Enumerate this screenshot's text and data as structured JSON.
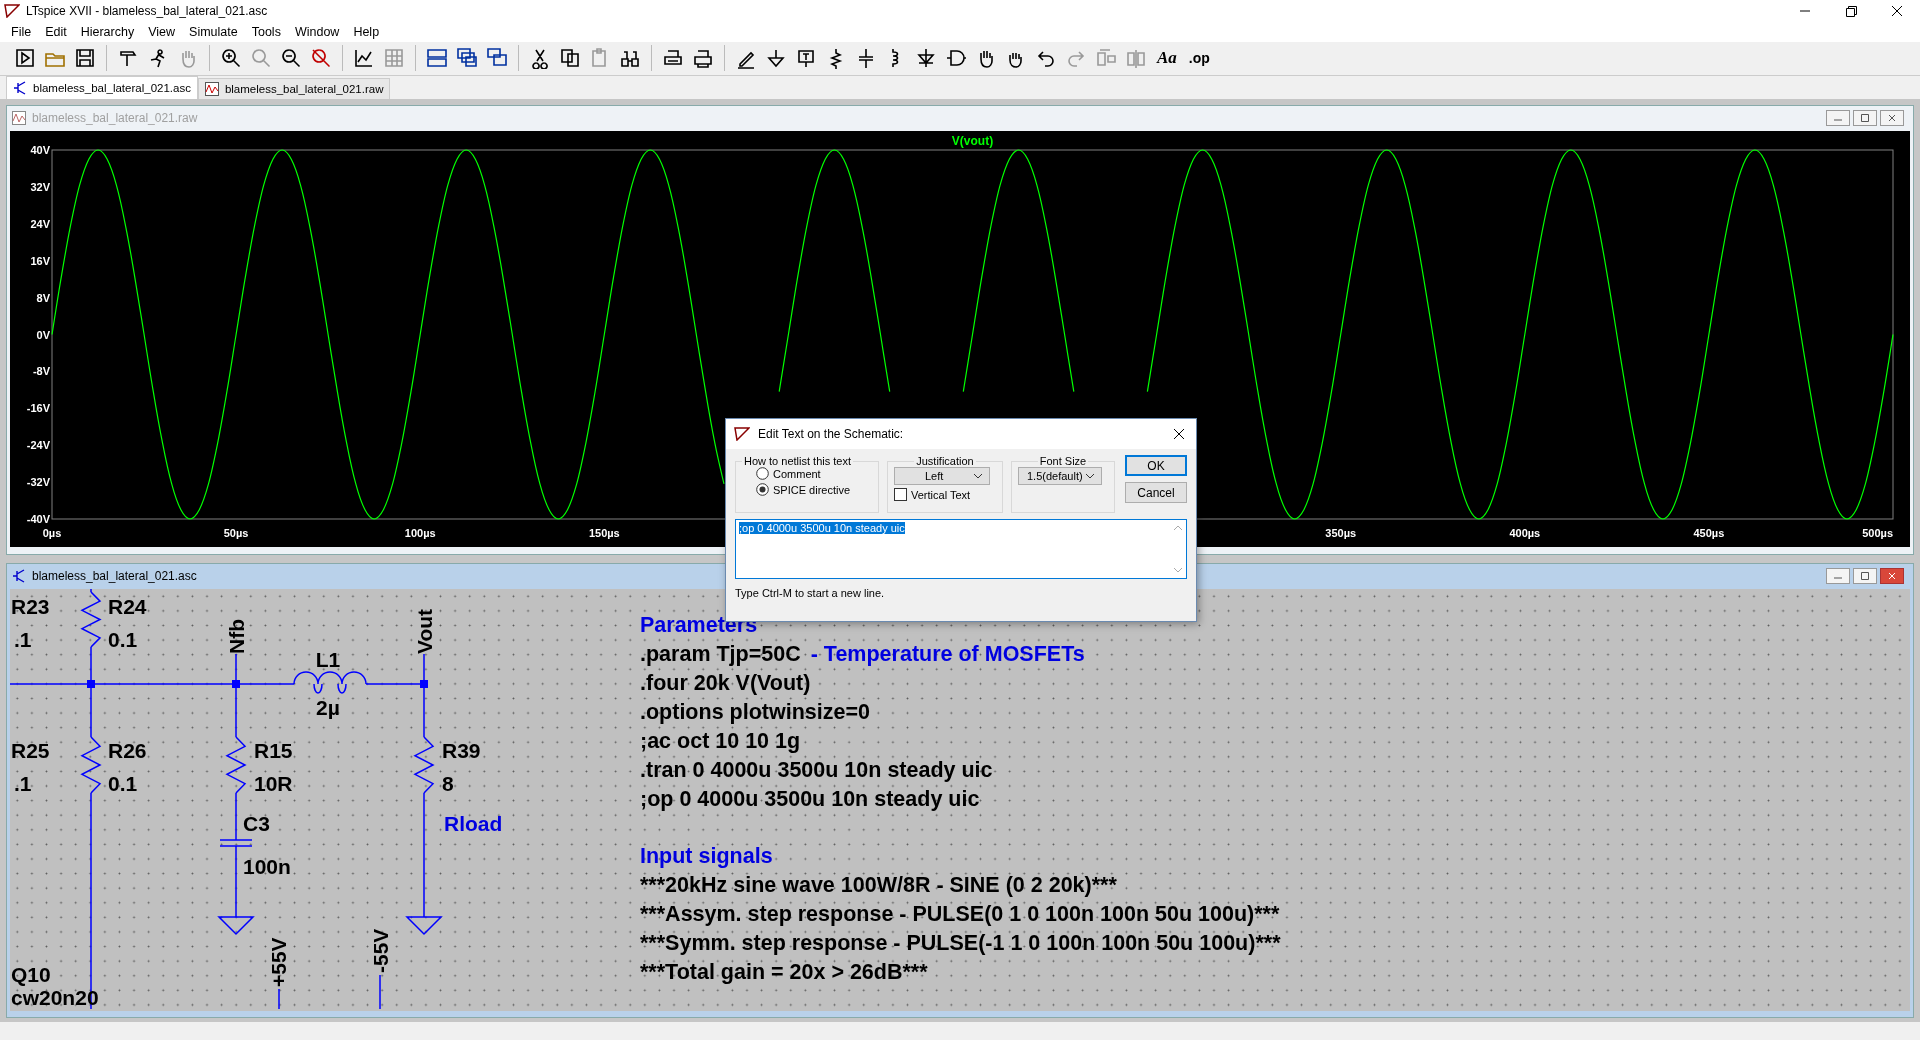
{
  "window": {
    "title": "LTspice XVII - blameless_bal_lateral_021.asc"
  },
  "menu": [
    "File",
    "Edit",
    "Hierarchy",
    "View",
    "Simulate",
    "Tools",
    "Window",
    "Help"
  ],
  "toolbar": {
    "font_button": "Aa",
    "op_button": ".op"
  },
  "tabs": [
    {
      "label": "blameless_bal_lateral_021.asc",
      "kind": "schematic",
      "selected": true
    },
    {
      "label": "blameless_bal_lateral_021.raw",
      "kind": "waveform",
      "selected": false
    }
  ],
  "plot_window": {
    "title": "blameless_bal_lateral_021.raw",
    "active": false,
    "chart_data": {
      "type": "line",
      "xlim": [
        0,
        500
      ],
      "ylim": [
        -40,
        40
      ],
      "yticks": [
        {
          "value": 40,
          "label": "40V"
        },
        {
          "value": 32,
          "label": "32V"
        },
        {
          "value": 24,
          "label": "24V"
        },
        {
          "value": 16,
          "label": "16V"
        },
        {
          "value": 8,
          "label": "8V"
        },
        {
          "value": 0,
          "label": "0V"
        },
        {
          "value": -8,
          "label": "-8V"
        },
        {
          "value": -16,
          "label": "-16V"
        },
        {
          "value": -24,
          "label": "-24V"
        },
        {
          "value": -32,
          "label": "-32V"
        },
        {
          "value": -40,
          "label": "-40V"
        }
      ],
      "xticks": [
        {
          "value": 0,
          "label": "0µs"
        },
        {
          "value": 50,
          "label": "50µs"
        },
        {
          "value": 100,
          "label": "100µs"
        },
        {
          "value": 150,
          "label": "150µs"
        },
        {
          "value": 350,
          "label": "350µs"
        },
        {
          "value": 400,
          "label": "400µs"
        },
        {
          "value": 450,
          "label": "450µs"
        },
        {
          "value": 500,
          "label": "500µs"
        }
      ],
      "x": [
        0,
        2.5,
        5,
        7.5,
        10,
        12.5,
        15,
        17.5,
        20,
        22.5,
        25,
        27.5,
        30,
        32.5,
        35,
        37.5,
        40,
        42.5,
        45,
        47.5,
        50,
        52.5,
        55,
        57.5,
        60,
        62.5,
        65,
        67.5,
        70,
        72.5,
        75,
        77.5,
        80,
        82.5,
        85,
        87.5,
        90,
        92.5,
        95,
        97.5,
        100,
        102.5,
        105,
        107.5,
        110,
        112.5,
        115,
        117.5,
        120,
        122.5,
        125,
        127.5,
        130,
        132.5,
        135,
        137.5,
        140,
        142.5,
        145,
        147.5,
        150,
        152.5,
        155,
        157.5,
        160,
        162.5,
        165,
        167.5,
        170,
        172.5,
        175,
        177.5,
        180,
        182.5,
        185,
        187.5,
        190,
        192.5,
        195,
        197.5,
        200,
        202.5,
        205,
        207.5,
        210,
        212.5,
        215,
        217.5,
        220,
        222.5,
        225,
        227.5,
        230,
        232.5,
        235,
        237.5,
        240,
        242.5,
        245,
        247.5,
        250,
        252.5,
        255,
        257.5,
        260,
        262.5,
        265,
        267.5,
        270,
        272.5,
        275,
        277.5,
        280,
        282.5,
        285,
        287.5,
        290,
        292.5,
        295,
        297.5,
        300,
        302.5,
        305,
        307.5,
        310,
        312.5,
        315,
        317.5,
        320,
        322.5,
        325,
        327.5,
        330,
        332.5,
        335,
        337.5,
        340,
        342.5,
        345,
        347.5,
        350,
        352.5,
        355,
        357.5,
        360,
        362.5,
        365,
        367.5,
        370,
        372.5,
        375,
        377.5,
        380,
        382.5,
        385,
        387.5,
        390,
        392.5,
        395,
        397.5,
        400,
        402.5,
        405,
        407.5,
        410,
        412.5,
        415,
        417.5,
        420,
        422.5,
        425,
        427.5,
        430,
        432.5,
        435,
        437.5,
        440,
        442.5,
        445,
        447.5,
        450,
        452.5,
        455,
        457.5,
        460,
        462.5,
        465,
        467.5,
        470,
        472.5,
        475,
        477.5,
        480,
        482.5,
        485,
        487.5,
        490,
        492.5,
        495,
        497.5,
        500
      ],
      "series": [
        {
          "name": "V(vout)",
          "color": "#00ff00",
          "values": [
            0,
            12.4,
            23.5,
            32.4,
            38,
            40,
            38,
            32.4,
            23.5,
            12.4,
            0,
            -12.4,
            -23.5,
            -32.4,
            -38,
            -40,
            -38,
            -32.4,
            -23.5,
            -12.4,
            0,
            12.4,
            23.5,
            32.4,
            38,
            40,
            38,
            32.4,
            23.5,
            12.4,
            0,
            -12.4,
            -23.5,
            -32.4,
            -38,
            -40,
            -38,
            -32.4,
            -23.5,
            -12.4,
            0,
            12.4,
            23.5,
            32.4,
            38,
            40,
            38,
            32.4,
            23.5,
            12.4,
            0,
            -12.4,
            -23.5,
            -32.4,
            -38,
            -40,
            -38,
            -32.4,
            -23.5,
            -12.4,
            0,
            12.4,
            23.5,
            32.4,
            38,
            40,
            38,
            32.4,
            23.5,
            12.4,
            0,
            -12.4,
            -23.5,
            -32.4,
            null,
            null,
            null,
            null,
            null,
            -12.4,
            0,
            12.4,
            23.5,
            32.4,
            38,
            40,
            38,
            32.4,
            23.5,
            12.4,
            0,
            -12.4,
            null,
            null,
            null,
            null,
            null,
            null,
            null,
            -12.4,
            0,
            12.4,
            23.5,
            32.4,
            38,
            40,
            38,
            32.4,
            23.5,
            12.4,
            0,
            -12.4,
            null,
            null,
            null,
            null,
            null,
            null,
            null,
            -12.4,
            0,
            12.4,
            23.5,
            32.4,
            38,
            40,
            38,
            32.4,
            23.5,
            12.4,
            0,
            -12.4,
            -23.5,
            -32.4,
            -38,
            -40,
            -38,
            -32.4,
            -23.5,
            -12.4,
            0,
            12.4,
            23.5,
            32.4,
            38,
            40,
            38,
            32.4,
            23.5,
            12.4,
            0,
            -12.4,
            -23.5,
            -32.4,
            -38,
            -40,
            -38,
            -32.4,
            -23.5,
            -12.4,
            0,
            12.4,
            23.5,
            32.4,
            38,
            40,
            38,
            32.4,
            23.5,
            12.4,
            0,
            -12.4,
            -23.5,
            -32.4,
            -38,
            -40,
            -38,
            -32.4,
            -23.5,
            -12.4,
            0,
            12.4,
            23.5,
            32.4,
            38,
            40,
            38,
            32.4,
            23.5,
            12.4,
            0,
            -12.4,
            -23.5,
            -32.4,
            -38,
            -40,
            -38,
            -32.4,
            -23.5,
            -12.4,
            0
          ]
        }
      ]
    }
  },
  "schematic_window": {
    "title": "blameless_bal_lateral_021.asc",
    "active": true,
    "labels": [
      {
        "text": "R23",
        "kind": "ref"
      },
      {
        "text": ".1",
        "kind": "ref"
      },
      {
        "text": "R24",
        "kind": "ref"
      },
      {
        "text": "0.1",
        "kind": "ref"
      },
      {
        "text": "R25",
        "kind": "ref"
      },
      {
        "text": ".1",
        "kind": "ref"
      },
      {
        "text": "R26",
        "kind": "ref"
      },
      {
        "text": "0.1",
        "kind": "ref"
      },
      {
        "text": "Nfb",
        "kind": "net"
      },
      {
        "text": "L1",
        "kind": "ref"
      },
      {
        "text": "2µ",
        "kind": "ref"
      },
      {
        "text": "Vout",
        "kind": "net"
      },
      {
        "text": "R15",
        "kind": "ref"
      },
      {
        "text": "10R",
        "kind": "ref"
      },
      {
        "text": "C3",
        "kind": "ref"
      },
      {
        "text": "100n",
        "kind": "ref"
      },
      {
        "text": "R39",
        "kind": "ref"
      },
      {
        "text": "8",
        "kind": "ref"
      },
      {
        "text": "Rload",
        "kind": "comment"
      },
      {
        "text": "+55V",
        "kind": "net"
      },
      {
        "text": "-55V",
        "kind": "net"
      },
      {
        "text": "Q10",
        "kind": "ref"
      },
      {
        "text": "cw20n20",
        "kind": "ref"
      }
    ],
    "sections": [
      {
        "heading": "Parameters",
        "lines": [
          {
            "text": ".param Tjp=50C",
            "comment": "- Temperature of MOSFETs"
          },
          {
            "text": ".four 20k V(Vout)"
          },
          {
            "text": ".options plotwinsize=0"
          },
          {
            "text": ";ac oct 10 10 1g"
          },
          {
            "text": ".tran 0 4000u 3500u 10n steady uic"
          },
          {
            "text": ";op 0 4000u 3500u 10n steady uic"
          }
        ]
      },
      {
        "heading": "Input signals",
        "lines": [
          {
            "text": "***20kHz sine wave 100W/8R - SINE (0 2 20k)***"
          },
          {
            "text": "***Assym. step response - PULSE(0 1 0 100n 100n 50u 100u)***"
          },
          {
            "text": "***Symm. step response - PULSE(-1 1 0 100n 100n 50u 100u)***"
          },
          {
            "text": "***Total gain = 20x > 26dB***"
          }
        ]
      }
    ]
  },
  "dialog": {
    "title": "Edit Text on the Schematic:",
    "netlist_group": {
      "label": "How to netlist this text",
      "options": [
        {
          "label": "Comment",
          "selected": false
        },
        {
          "label": "SPICE directive",
          "selected": true
        }
      ]
    },
    "justification": {
      "label": "Justification",
      "value": "Left"
    },
    "vertical_text": {
      "label": "Vertical Text",
      "checked": false
    },
    "font_size": {
      "label": "Font Size",
      "value": "1.5(default)"
    },
    "buttons": [
      {
        "label": "OK",
        "kind": "default"
      },
      {
        "label": "Cancel",
        "kind": "normal"
      }
    ],
    "text": {
      "value": ";op 0 4000u 3500u 10n steady uic",
      "selected": true
    },
    "hint": "Type Ctrl-M to start a new line."
  }
}
